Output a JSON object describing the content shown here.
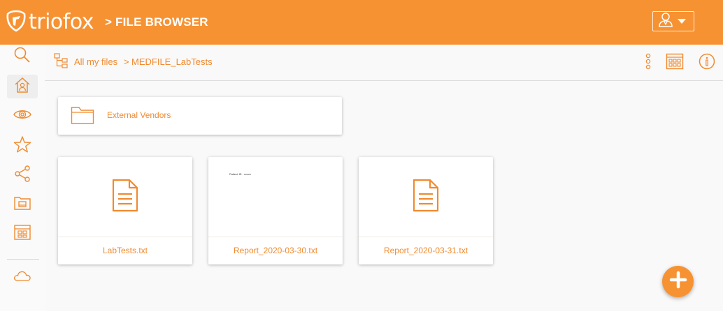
{
  "app": {
    "logo_text": "triofox",
    "heading": "> FILE BROWSER",
    "brand_color": "#f79232",
    "accent_color": "#f08a2f"
  },
  "header": {
    "user_menu_icon": "user-icon",
    "caret_icon": "caret-down-icon"
  },
  "sidebar": {
    "items": [
      {
        "name": "search",
        "icon": "search-icon",
        "active": false
      },
      {
        "name": "home",
        "icon": "home-icon",
        "active": true
      },
      {
        "name": "watch",
        "icon": "eye-icon",
        "active": false
      },
      {
        "name": "favorites",
        "icon": "star-icon",
        "active": false
      },
      {
        "name": "shared",
        "icon": "share-icon",
        "active": false
      },
      {
        "name": "team-folders",
        "icon": "folder-drive-icon",
        "active": false
      },
      {
        "name": "dashboard",
        "icon": "dashboard-icon",
        "active": false
      },
      {
        "name": "cloud",
        "icon": "cloud-icon",
        "active": false
      }
    ]
  },
  "breadcrumb": {
    "tree_icon": "folder-tree-icon",
    "root": "All my files",
    "separator": ">",
    "current": "MEDFILE_LabTests"
  },
  "toolbar": {
    "more_icon": "more-vertical-icon",
    "view_icon": "grid-view-icon",
    "info_icon": "info-icon"
  },
  "folders": [
    {
      "name": "External Vendors",
      "icon": "folder-icon"
    }
  ],
  "files": [
    {
      "name": "LabTests.txt",
      "icon": "document-icon",
      "preview": ""
    },
    {
      "name": "Report_2020-03-30.txt",
      "icon": "",
      "preview": "Patient ID : xxxxx"
    },
    {
      "name": "Report_2020-03-31.txt",
      "icon": "document-icon",
      "preview": ""
    }
  ],
  "fab": {
    "icon": "plus-icon"
  }
}
